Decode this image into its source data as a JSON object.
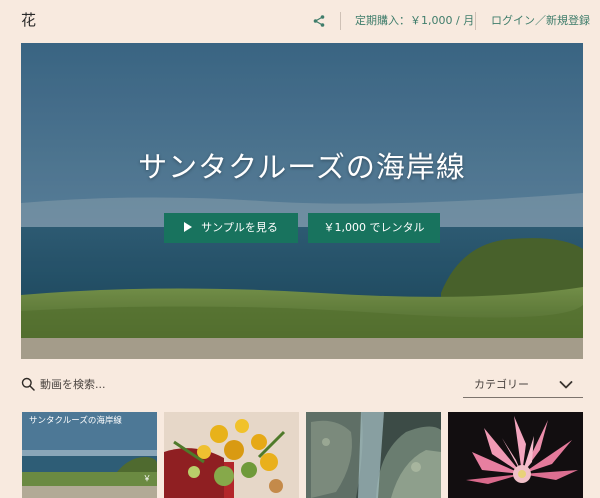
{
  "header": {
    "brand": "花",
    "subscription": "定期購入：￥1,000 / 月",
    "auth": "ログイン／新規登録"
  },
  "hero": {
    "title": "サンタクルーズの海岸線",
    "sample_button": "サンプルを見る",
    "rent_button": "￥1,000 でレンタル"
  },
  "search": {
    "placeholder": "動画を検索...",
    "category_label": "カテゴリー"
  },
  "thumbnails": [
    {
      "title": "サンタクルーズの海岸線",
      "price": "￥"
    },
    {
      "title": ""
    },
    {
      "title": ""
    },
    {
      "title": ""
    }
  ],
  "colors": {
    "background": "#f8eadf",
    "accent": "#18735e",
    "link": "#3f7d6b"
  },
  "icons": {
    "share": "share-icon",
    "search": "search-icon",
    "play": "play-icon",
    "dropdown": "chevron-down-icon"
  }
}
